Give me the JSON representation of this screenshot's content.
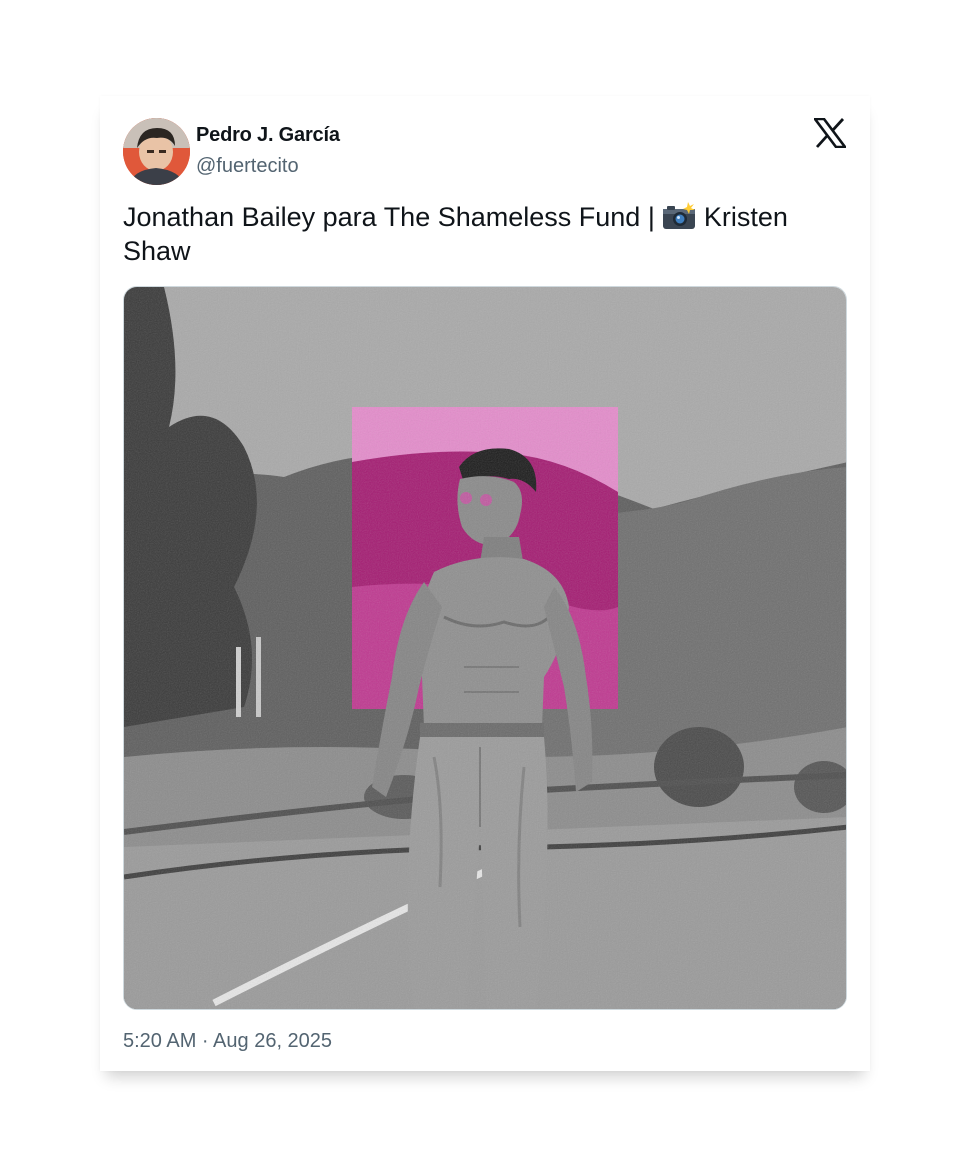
{
  "author": {
    "display_name": "Pedro J. García",
    "handle": "@fuertecito",
    "avatar_icon": "profile-photo"
  },
  "platform": {
    "logo_icon": "x-logo-icon"
  },
  "tweet": {
    "text_before_emoji": "Jonathan Bailey para The Shameless Fund | ",
    "emoji": "camera-with-flash-icon",
    "text_after_emoji": " Kristen Shaw",
    "timestamp": "5:20 AM · Aug 26, 2025"
  },
  "media": {
    "type": "photo",
    "style": "black-and-white with magenta rectangle overlay",
    "accent_color": "#e048a8"
  },
  "colors": {
    "text_primary": "#0f1419",
    "text_secondary": "#536471",
    "card_background": "#ffffff"
  }
}
